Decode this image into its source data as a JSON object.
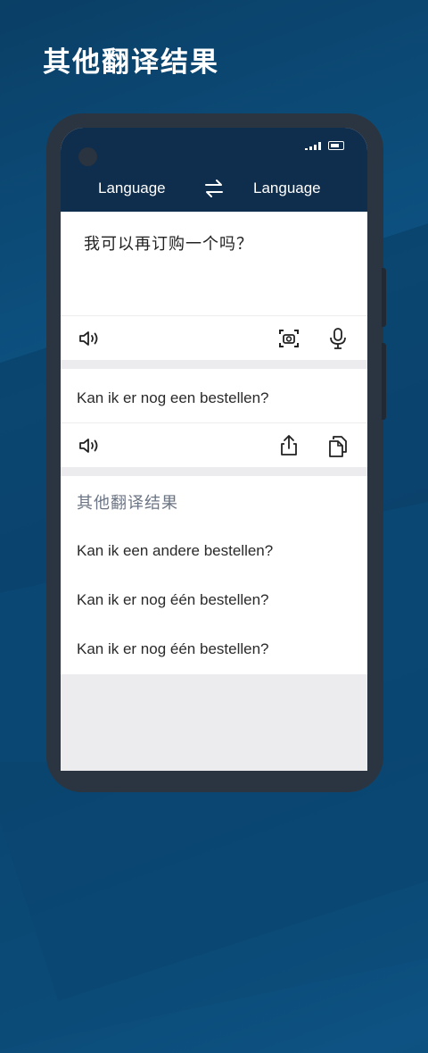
{
  "headline": "其他翻译结果",
  "header": {
    "source_lang": "Language",
    "target_lang": "Language"
  },
  "input": {
    "text": "我可以再订购一个吗？"
  },
  "translation": {
    "text": "Kan ik er nog een bestellen?"
  },
  "other_results": {
    "title": "其他翻译结果",
    "items": [
      "Kan ik een andere bestellen?",
      "Kan ik er nog één bestellen?",
      "Kan ik er nog één bestellen?"
    ]
  },
  "icons": {
    "speaker": "speaker-icon",
    "camera": "camera-scan-icon",
    "mic": "microphone-icon",
    "share": "share-icon",
    "copy": "copy-icon",
    "swap": "swap-icon"
  },
  "colors": {
    "header_bg": "#0f2d4c",
    "background": "#0d4f80",
    "section_title": "#6c7584"
  }
}
